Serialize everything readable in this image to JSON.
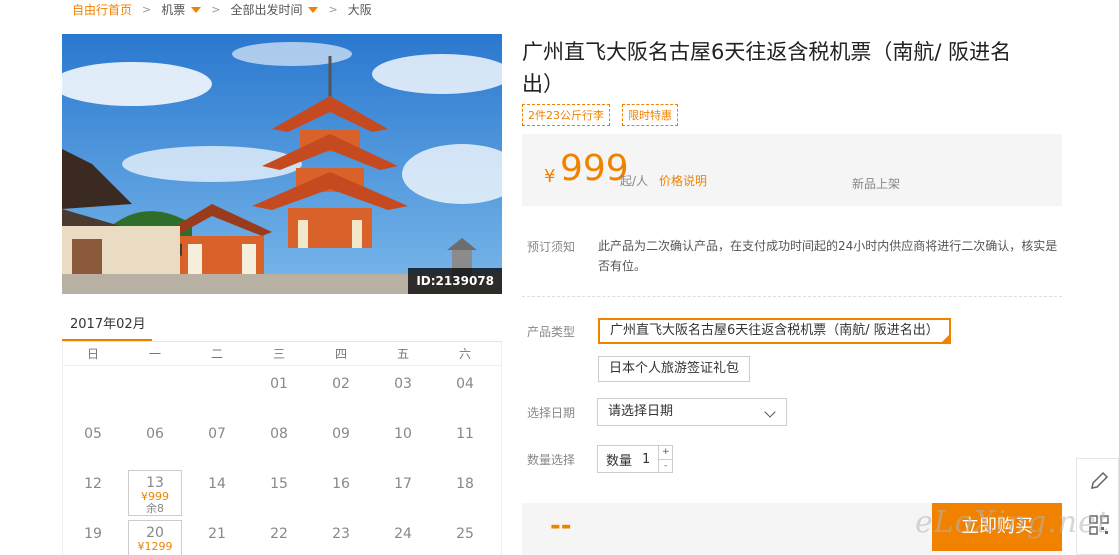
{
  "breadcrumb": {
    "home": "自由行首页",
    "item1": "机票",
    "item2": "全部出发时间",
    "item3": "大阪"
  },
  "photo": {
    "id_label": "ID:2139078"
  },
  "product": {
    "title": "广州直飞大阪名古屋6天往返含税机票（南航/ 阪进名出）",
    "tags": [
      "2件23公斤行李",
      "限时特惠"
    ]
  },
  "price": {
    "currency": "¥",
    "amount": "999",
    "unit": "起/人",
    "explain_link": "价格说明",
    "status": "新品上架"
  },
  "notice": {
    "label": "预订须知",
    "text": "此产品为二次确认产品，在支付成功时间起的24小时内供应商将进行二次确认，核实是否有位。"
  },
  "product_type": {
    "label": "产品类型",
    "options": [
      "广州直飞大阪名古屋6天往返含税机票（南航/ 阪进名出）",
      "日本个人旅游签证礼包"
    ]
  },
  "date_select": {
    "label": "选择日期",
    "value": "请选择日期"
  },
  "quantity": {
    "label": "数量选择",
    "prefix": "数量",
    "value": "1",
    "plus": "+",
    "minus": "-"
  },
  "buy": {
    "total": "--",
    "button": "立即购买"
  },
  "calendar": {
    "month": "2017年02月",
    "weekdays": [
      "日",
      "一",
      "二",
      "三",
      "四",
      "五",
      "六"
    ],
    "weeks": [
      [
        {
          "d": ""
        },
        {
          "d": ""
        },
        {
          "d": ""
        },
        {
          "d": "01"
        },
        {
          "d": "02"
        },
        {
          "d": "03"
        },
        {
          "d": "04"
        }
      ],
      [
        {
          "d": "05"
        },
        {
          "d": "06"
        },
        {
          "d": "07"
        },
        {
          "d": "08"
        },
        {
          "d": "09"
        },
        {
          "d": "10"
        },
        {
          "d": "11"
        }
      ],
      [
        {
          "d": "12"
        },
        {
          "d": "13",
          "price": "¥999",
          "left": "余8"
        },
        {
          "d": "14"
        },
        {
          "d": "15"
        },
        {
          "d": "16"
        },
        {
          "d": "17"
        },
        {
          "d": "18"
        }
      ],
      [
        {
          "d": "19"
        },
        {
          "d": "20",
          "price": "¥1299"
        },
        {
          "d": "21"
        },
        {
          "d": "22"
        },
        {
          "d": "23"
        },
        {
          "d": "24"
        },
        {
          "d": "25"
        }
      ]
    ]
  },
  "watermark": "eLoXing.net",
  "colors": {
    "accent": "#f08200",
    "panel": "#f5f5f5"
  }
}
